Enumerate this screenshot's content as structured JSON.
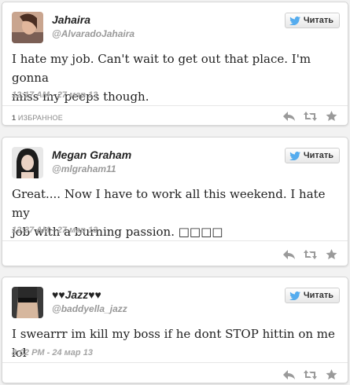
{
  "tweets": [
    {
      "name": "Jahaira",
      "handle": "@AlvaradoJahaira",
      "follow_label": "Читать",
      "text_lines": [
        "I hate my job. Can't wait to get out that place. I'm gonna",
        "miss my peeps though."
      ],
      "time": "12:17 AM",
      "date_sep": "-",
      "date": "27 мар 13",
      "favorites_count": "1",
      "favorites_label": "ИЗБРАННОЕ"
    },
    {
      "name": "Megan Graham",
      "handle": "@mlgraham11",
      "follow_label": "Читать",
      "text_lines": [
        "Great.... Now I have to work all this weekend. I hate my",
        "job with a burning passion. □□□□"
      ],
      "time": "12:37 AM",
      "date_sep": "-",
      "date": "27 мар 13"
    },
    {
      "name": "♥♥Jazz♥♥",
      "handle": "@baddyella_jazz",
      "follow_label": "Читать",
      "text_lines": [
        "I swearrr im kill my boss if he dont STOP hittin on me lol"
      ],
      "time": "8:02 PM",
      "date_sep": "-",
      "date": "24 мар 13"
    }
  ],
  "colors": {
    "twitter_blue": "#55acee",
    "icon_gray": "#9a9a9a",
    "time_gray": "#a5a5a5"
  },
  "icons": [
    "twitter-bird-icon",
    "reply-icon",
    "retweet-icon",
    "favorite-star-icon"
  ]
}
